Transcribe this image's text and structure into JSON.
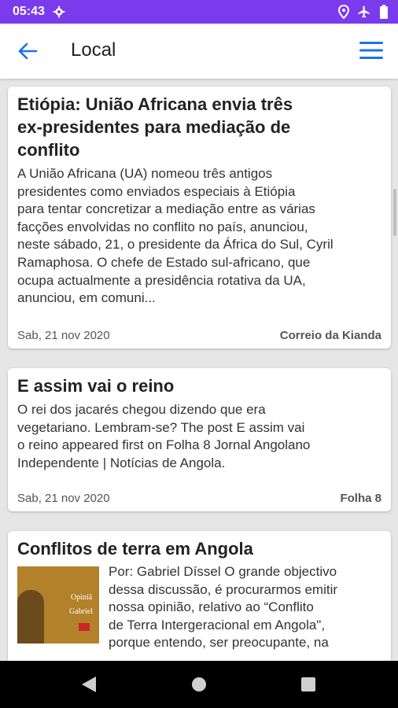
{
  "status_bar": {
    "time": "05:43",
    "icons": [
      "gear-icon",
      "location-icon",
      "airplane-icon",
      "battery-icon"
    ]
  },
  "app_bar": {
    "title": "Local",
    "back_icon": "arrow-left-icon",
    "menu_icon": "hamburger-menu-icon"
  },
  "articles": [
    {
      "headline_lines": [
        "Etiópia: União Africana envia três",
        "ex-presidentes para mediação de",
        "conflito"
      ],
      "body_lines": [
        "A União Africana (UA) nomeou três antigos",
        "presidentes como enviados especiais à Etiópia",
        "para tentar concretizar a mediação entre as várias",
        "facções envolvidas no conflito no país, anunciou,",
        "neste sábado, 21, o presidente da África do Sul, Cyril",
        "Ramaphosa. O chefe de Estado sul-africano, que",
        "ocupa actualmente a presidência rotativa da UA,",
        "anunciou, em comuni..."
      ],
      "date": "Sab, 21 nov 2020",
      "source": "Correio da Kianda"
    },
    {
      "headline_lines": [
        "E assim vai o reino"
      ],
      "body_lines": [
        "O rei dos jacarés chegou dizendo que era",
        "vegetariano. Lembram-se? The post E assim vai",
        "o reino appeared first on Folha 8 Jornal Angolano",
        "Independente | Notícias de Angola."
      ],
      "date": "Sab, 21 nov 2020",
      "source": "Folha 8"
    },
    {
      "headline_lines": [
        "Conflitos de terra em Angola"
      ],
      "thumbnail": {
        "line1": "Opiniã",
        "line2": "Gabriel"
      },
      "body_lines": [
        "Por: Gabriel Díssel O grande objectivo",
        "dessa discussão, é procurarmos emitir",
        "nossa opinião, relativo ao “Conflito",
        "de Terra Intergeracional em Angola\",",
        "porque entendo, ser preocupante, na"
      ]
    }
  ],
  "nav_bar": {
    "icons": [
      "back-triangle-icon",
      "home-circle-icon",
      "recents-square-icon"
    ]
  },
  "colors": {
    "status_bar": "#7c3aed",
    "accent": "#1a73e8"
  }
}
